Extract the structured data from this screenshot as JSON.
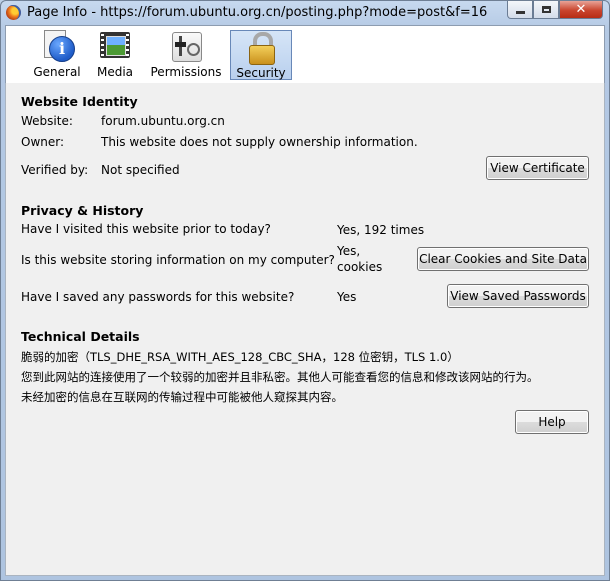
{
  "window": {
    "title": "Page Info - https://forum.ubuntu.org.cn/posting.php?mode=post&f=16"
  },
  "tabs": [
    {
      "key": "general",
      "label": "General",
      "icon": "info-icon"
    },
    {
      "key": "media",
      "label": "Media",
      "icon": "film-icon"
    },
    {
      "key": "permissions",
      "label": "Permissions",
      "icon": "permissions-icon"
    },
    {
      "key": "security",
      "label": "Security",
      "icon": "lock-icon",
      "selected": true
    }
  ],
  "identity": {
    "heading": "Website Identity",
    "website_label": "Website:",
    "website_value": "forum.ubuntu.org.cn",
    "owner_label": "Owner:",
    "owner_value": "This website does not supply ownership information.",
    "verified_label": "Verified by:",
    "verified_value": "Not specified",
    "view_cert_button": "View Certificate"
  },
  "privacy": {
    "heading": "Privacy & History",
    "visited_question": "Have I visited this website prior to today?",
    "visited_answer": "Yes, 192 times",
    "cookies_question": "Is this website storing information on my computer?",
    "cookies_answer_line1": "Yes,",
    "cookies_answer_line2": "cookies",
    "clear_cookies_button": "Clear Cookies and Site Data",
    "passwords_question": "Have I saved any passwords for this website?",
    "passwords_answer": "Yes",
    "view_passwords_button": "View Saved Passwords"
  },
  "technical": {
    "heading": "Technical Details",
    "line1": "脆弱的加密（TLS_DHE_RSA_WITH_AES_128_CBC_SHA，128 位密钥，TLS 1.0）",
    "line2": "您到此网站的连接使用了一个较弱的加密并且非私密。其他人可能查看您的信息和修改该网站的行为。",
    "line3": "未经加密的信息在互联网的传输过程中可能被他人窥探其内容。"
  },
  "help_button": "Help"
}
